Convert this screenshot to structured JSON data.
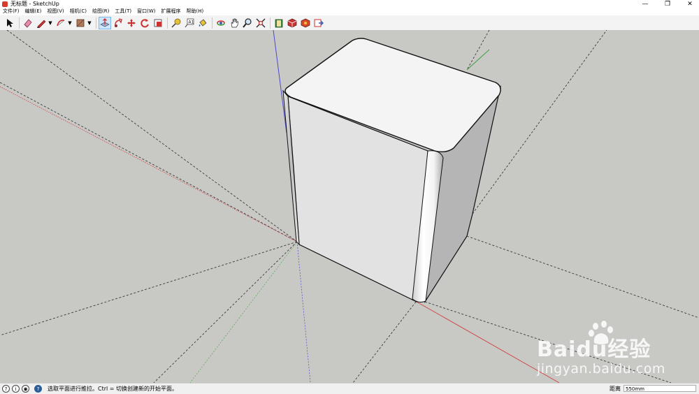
{
  "window": {
    "title": "无标题 - SketchUp",
    "controls": {
      "minimize": "—",
      "restore": "❐",
      "close": "✕"
    }
  },
  "menubar": {
    "items": [
      {
        "label": "文件(F)"
      },
      {
        "label": "编辑(E)"
      },
      {
        "label": "视图(V)"
      },
      {
        "label": "相机(C)"
      },
      {
        "label": "绘图(R)"
      },
      {
        "label": "工具(T)"
      },
      {
        "label": "窗口(W)"
      },
      {
        "label": "扩展程序"
      },
      {
        "label": "帮助(H)"
      }
    ]
  },
  "toolbar": {
    "tools": [
      {
        "icon": "select-arrow-icon"
      },
      {
        "icon": "eraser-icon"
      },
      {
        "icon": "pencil-line-icon"
      },
      {
        "icon": "arc-icon"
      },
      {
        "icon": "rectangle-shape-icon"
      },
      {
        "icon": "push-pull-icon"
      },
      {
        "icon": "follow-me-icon"
      },
      {
        "icon": "move-icon"
      },
      {
        "icon": "rotate-icon"
      },
      {
        "icon": "scale-icon"
      },
      {
        "icon": "tape-measure-icon"
      },
      {
        "icon": "text-icon"
      },
      {
        "icon": "paint-bucket-icon"
      },
      {
        "icon": "orbit-icon"
      },
      {
        "icon": "pan-icon"
      },
      {
        "icon": "zoom-icon"
      },
      {
        "icon": "zoom-extents-icon"
      },
      {
        "icon": "warehouse-icon"
      },
      {
        "icon": "extension-warehouse-icon"
      },
      {
        "icon": "layout-icon"
      },
      {
        "icon": "send-to-layout-icon"
      }
    ],
    "active_tool": "push-pull-icon"
  },
  "statusbar": {
    "message": "选取平面进行推拉。Ctrl = 切换创建新的开始平面。",
    "measurement_label": "距离",
    "measurement_value": "550mm"
  },
  "watermark": {
    "brand": "Baidu经验",
    "url": "jingyan.baidu.com"
  },
  "colors": {
    "viewport_bg": "#c8c8c5",
    "red_axis": "#d04040",
    "green_axis": "#3fa03f",
    "blue_axis": "#4a4ad0",
    "active_tool": "#cde6fb"
  }
}
